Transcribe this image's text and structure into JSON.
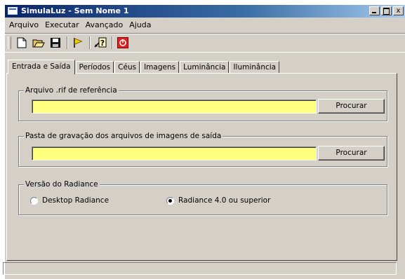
{
  "window": {
    "title": "SimulaLuz - Sem Nome 1",
    "controls": {
      "minimize": "_",
      "maximize": "□",
      "close": "x"
    }
  },
  "menu": [
    "Arquivo",
    "Executar",
    "Avançado",
    "Ajuda"
  ],
  "toolbar": {
    "buttons": [
      "new-file-icon",
      "open-folder-icon",
      "save-disk-icon",
      "run-flag-icon",
      "help-icon",
      "stop-icon"
    ]
  },
  "tabs": [
    "Entrada e Saída",
    "Períodos",
    "Céus",
    "Imagens",
    "Luminância",
    "Iluminância"
  ],
  "groups": {
    "reference_file": {
      "label": "Arquivo .rif de referência",
      "value": "",
      "button": "Procurar"
    },
    "output_folder": {
      "label": "Pasta de gravação dos arquivos de imagens de saída",
      "value": "",
      "button": "Procurar"
    },
    "radiance_version": {
      "label": "Versão do Radiance",
      "options": [
        "Desktop Radiance",
        "Radiance 4.0 ou superior"
      ],
      "selected": "Radiance 4.0 ou superior"
    }
  },
  "status": "",
  "colors": {
    "field_bg": "#ffff80",
    "titlebar_start": "#0a246a",
    "titlebar_end": "#a6caf0",
    "window_bg": "#d4d0c8"
  }
}
